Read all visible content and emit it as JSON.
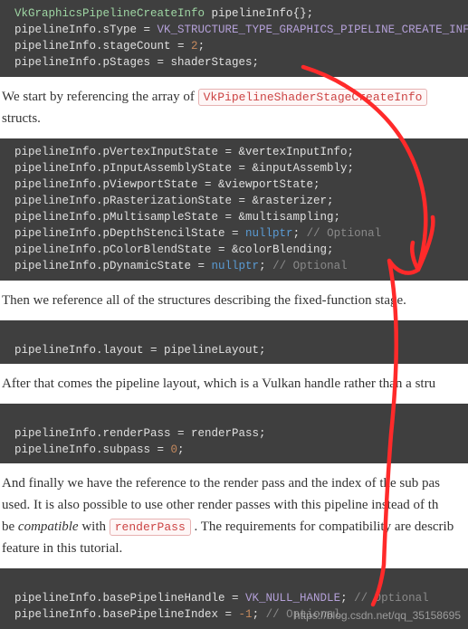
{
  "block1": {
    "l1_type": "VkGraphicsPipelineCreateInfo",
    "l1_rest": " pipelineInfo{};",
    "l2a": "pipelineInfo.sType = ",
    "l2_const": "VK_STRUCTURE_TYPE_GRAPHICS_PIPELINE_CREATE_INFO",
    "l2b": ";",
    "l3a": "pipelineInfo.stageCount = ",
    "l3_num": "2",
    "l3b": ";",
    "l4": "pipelineInfo.pStages = shaderStages;"
  },
  "prose1": {
    "a": "We start by referencing the array of ",
    "code": "VkPipelineShaderStageCreateInfo",
    "b": " structs."
  },
  "block2": {
    "l1": "pipelineInfo.pVertexInputState = &vertexInputInfo;",
    "l2": "pipelineInfo.pInputAssemblyState = &inputAssembly;",
    "l3": "pipelineInfo.pViewportState = &viewportState;",
    "l4": "pipelineInfo.pRasterizationState = &rasterizer;",
    "l5": "pipelineInfo.pMultisampleState = &multisampling;",
    "l6a": "pipelineInfo.pDepthStencilState = ",
    "l6_null": "nullptr",
    "l6b": "; ",
    "l6_comment": "// Optional",
    "l7": "pipelineInfo.pColorBlendState = &colorBlending;",
    "l8a": "pipelineInfo.pDynamicState = ",
    "l8_null": "nullptr",
    "l8b": "; ",
    "l8_comment": "// Optional"
  },
  "prose2": "Then we reference all of the structures describing the fixed-function stage.",
  "block3": {
    "l1": "pipelineInfo.layout = pipelineLayout;"
  },
  "prose3": "After that comes the pipeline layout, which is a Vulkan handle rather than a stru",
  "block4": {
    "l1": "pipelineInfo.renderPass = renderPass;",
    "l2a": "pipelineInfo.subpass = ",
    "l2_num": "0",
    "l2b": ";"
  },
  "prose4": {
    "a": "And finally we have the reference to the render pass and the index of the sub pas",
    "b": "used. It is also possible to use other render passes with this pipeline instead of th",
    "c_pre": "be ",
    "c_em": "compatible",
    "c_mid": " with ",
    "c_code": "renderPass",
    "c_post": " . The requirements for compatibility are describ",
    "d": "feature in this tutorial."
  },
  "block5": {
    "l1a": "pipelineInfo.basePipelineHandle = ",
    "l1_const": "VK_NULL_HANDLE",
    "l1b": "; ",
    "l1_comment": "// Optional",
    "l2a": "pipelineInfo.basePipelineIndex = ",
    "l2_num": "-1",
    "l2b": "; ",
    "l2_comment": "// Optional"
  },
  "watermark": "https://blog.csdn.net/qq_35158695"
}
